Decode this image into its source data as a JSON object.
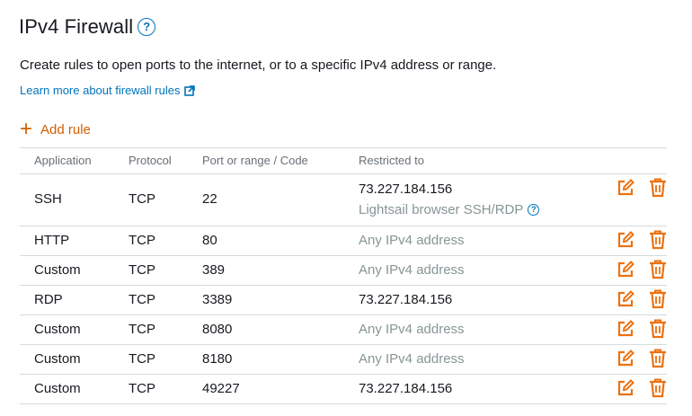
{
  "header": {
    "title": "IPv4 Firewall",
    "help": "?",
    "description": "Create rules to open ports to the internet, or to a specific IPv4 address or range.",
    "learn_more": "Learn more about firewall rules"
  },
  "add_rule": {
    "plus": "+",
    "label": "Add rule"
  },
  "table": {
    "columns": [
      "Application",
      "Protocol",
      "Port or range / Code",
      "Restricted to"
    ],
    "rows": [
      {
        "application": "SSH",
        "protocol": "TCP",
        "port": "22",
        "restricted": "73.227.184.156",
        "restricted_sub": "Lightsail browser SSH/RDP",
        "sub_help": "?"
      },
      {
        "application": "HTTP",
        "protocol": "TCP",
        "port": "80",
        "restricted": "Any IPv4 address"
      },
      {
        "application": "Custom",
        "protocol": "TCP",
        "port": "389",
        "restricted": "Any IPv4 address"
      },
      {
        "application": "RDP",
        "protocol": "TCP",
        "port": "3389",
        "restricted": "73.227.184.156"
      },
      {
        "application": "Custom",
        "protocol": "TCP",
        "port": "8080",
        "restricted": "Any IPv4 address"
      },
      {
        "application": "Custom",
        "protocol": "TCP",
        "port": "8180",
        "restricted": "Any IPv4 address"
      },
      {
        "application": "Custom",
        "protocol": "TCP",
        "port": "49227",
        "restricted": "73.227.184.156"
      }
    ]
  },
  "icons": {
    "edit": "edit-icon",
    "delete": "trash-icon",
    "external": "external-link-icon"
  },
  "colors": {
    "accent_orange": "#ec7211",
    "link_blue": "#0073bb",
    "muted": "#879596"
  }
}
